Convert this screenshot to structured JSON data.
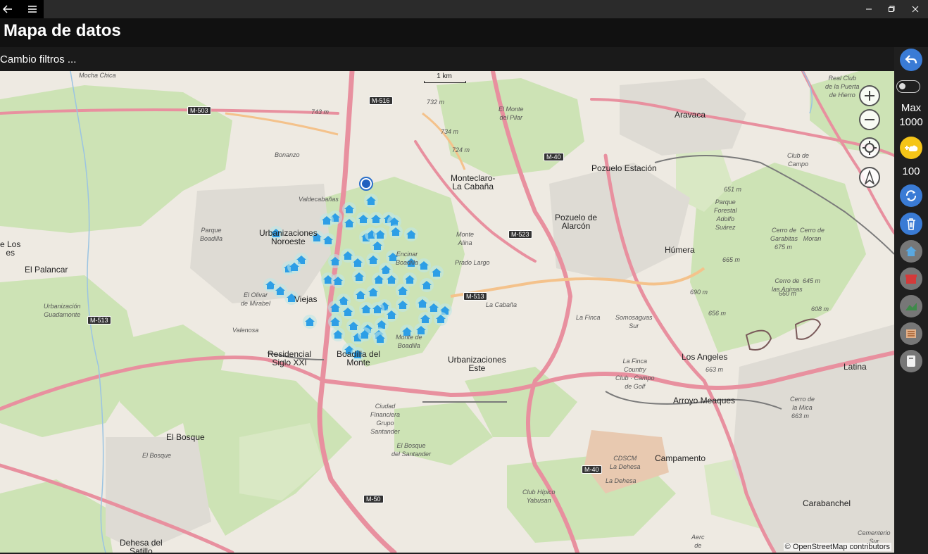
{
  "window": {
    "back_icon": "back-arrow-icon",
    "menu_icon": "hamburger-icon",
    "minimize_icon": "minimize-icon",
    "restore_icon": "restore-icon",
    "close_icon": "close-icon"
  },
  "header": {
    "title": "Mapa de datos"
  },
  "filters": {
    "label": "Cambio filtros ..."
  },
  "rightbar": {
    "max_label": "Max",
    "max_value": "1000",
    "count_value": "100",
    "colors": {
      "blue": "#3a7bd5",
      "yellow": "#f5c518",
      "gray": "#777777"
    }
  },
  "map": {
    "scale_label": "1 km",
    "attribution": "© OpenStreetMap contributors",
    "places": {
      "mocha_chica": "Mocha\nChica",
      "bonanzo": "Bonanzo",
      "valdecabanas": "Valdecabañas",
      "urb_noroeste": "Urbanizaciones\nNoroeste",
      "parque_boadilla": "Parque\nBoadilla",
      "el_palancar": "El Palancar",
      "urb_guadamonte": "Urbanización\nGuadamonte",
      "el_olivar": "El Olivar\nde Mirabel",
      "viejas": "Viejas",
      "valenosa": "Valenosa",
      "residencial": "Residencial\nSiglo XXI",
      "boadilla": "Boadilla del\nMonte",
      "monteclaro": "Monteclaro-\nLa Cabaña",
      "el_monte_pilar": "El Monte\ndel Pilar",
      "monte_alina": "Monte\nAlina",
      "prado_largo": "Prado Largo",
      "la_cabana": "La Cabaña",
      "la_finca": "La Finca",
      "somosaguas": "Somosaguas\nSur",
      "finca_country": "La Finca\nCountry\nClub · Campo\nde Golf",
      "urb_este": "Urbanizaciones\nEste",
      "pozuelo_estacion": "Pozuelo Estación",
      "pozuelo_alarcon": "Pozuelo de\nAlarcón",
      "aravaca": "Aravaca",
      "humera": "Húmera",
      "parque_forestal": "Parque\nForestal\nAdolfo\nSuárez",
      "los_angeles": "Los Angeles",
      "arroyo_meaques": "Arroyo Meaques",
      "latina": "Latina",
      "club_campo": "Club de\nCampo",
      "cerro_garabitas": "Cerro de\nGarabitas",
      "cerro_moran": "Cerro de\nMoran",
      "cerro_animas": "Cerro de\nlas Animas",
      "cerro_mica": "Cerro de\nla Mica",
      "real_club": "Real Club\nde la Puerta\nde Hierro",
      "ciudad_financiera": "Ciudad\nFinanciera\nGrupo\nSantander",
      "bosque_santander": "El Bosque\ndel Santander",
      "el_bosque": "El Bosque",
      "el_bosque2": "El Bosque",
      "cdscm": "CDSCM\nLa Dehesa",
      "la_dehesa": "La Dehesa",
      "campamento": "Campamento",
      "club_hipico": "Club Hípico\nYabusan",
      "carabanchel": "Carabanchel",
      "dehesa_satillo": "Dehesa del\nSatillo",
      "cementerio": "Cementerio\nSur",
      "los_": "e Los\nes",
      "monte_boadilla": "Monte de\nBoadilla",
      "encinar": "Encinar\nBoadilla",
      "aero": "Aerc\nde"
    },
    "roads": {
      "m503": "M-503",
      "m516": "M-516",
      "m513": "M-513",
      "m513b": "M-513",
      "m40": "M-40",
      "m40b": "M-40",
      "m523": "M-523",
      "m50": "M-50"
    },
    "elevations": {
      "e743": "743 m",
      "e732": "732 m",
      "e734": "734 m",
      "e724": "724 m",
      "e651": "651 m",
      "e665": "665 m",
      "e690": "690 m",
      "e656": "656 m",
      "e663": "663 m",
      "e675": "675 m",
      "e645": "645 m",
      "e660": "660 m",
      "e608": "608 m",
      "e663b": "663 m"
    }
  }
}
